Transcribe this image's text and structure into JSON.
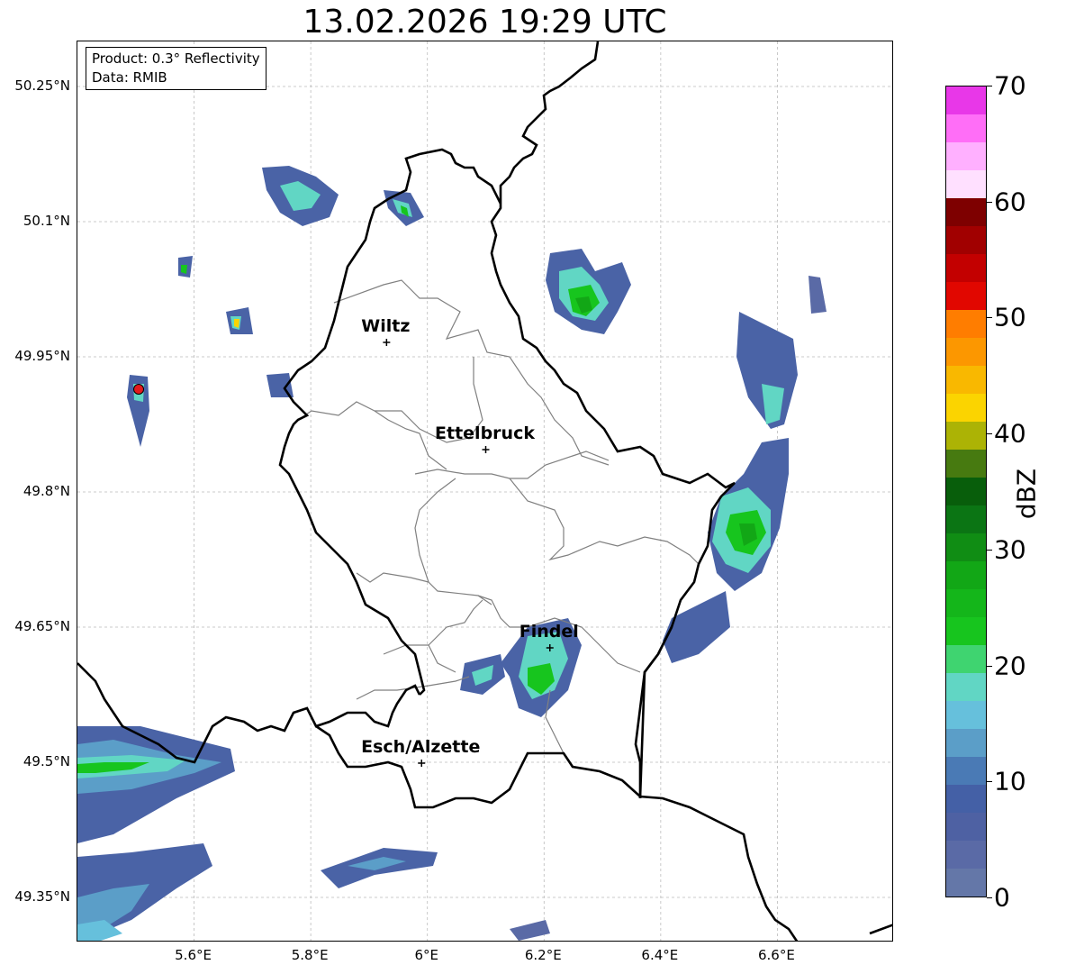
{
  "title": "13.02.2026 19:29 UTC",
  "info_box": {
    "product": "Product: 0.3° Reflectivity",
    "data": "Data: RMIB"
  },
  "y_ticks": [
    "50.25°N",
    "50.1°N",
    "49.95°N",
    "49.8°N",
    "49.65°N",
    "49.5°N",
    "49.35°N"
  ],
  "x_ticks": [
    "5.6°E",
    "5.8°E",
    "6°E",
    "6.2°E",
    "6.4°E",
    "6.6°E"
  ],
  "cities": [
    {
      "name": "Wiltz",
      "lon": 5.93,
      "lat": 49.966
    },
    {
      "name": "Ettelbruck",
      "lon": 6.1,
      "lat": 49.847
    },
    {
      "name": "Findel",
      "lon": 6.21,
      "lat": 49.627
    },
    {
      "name": "Esch/Alzette",
      "lon": 5.99,
      "lat": 49.499
    }
  ],
  "radar_site": {
    "lon": 5.505,
    "lat": 49.914,
    "color": "#e31a1c"
  },
  "colorbar": {
    "label": "dBZ",
    "ticks": [
      "0",
      "10",
      "20",
      "30",
      "40",
      "50",
      "60",
      "70"
    ],
    "colors": [
      "#6477a8",
      "#5a6aa6",
      "#4e61a3",
      "#4460a6",
      "#4a7ab5",
      "#5b9ec8",
      "#66c0dc",
      "#61d6c4",
      "#3fd470",
      "#17c51e",
      "#14b61a",
      "#12a716",
      "#108d14",
      "#0b7514",
      "#085e0b",
      "#477a10",
      "#acb305",
      "#fbd400",
      "#f9b800",
      "#fc9700",
      "#ff7d00",
      "#e10700",
      "#c30000",
      "#a10000",
      "#7e0000",
      "#ffe0ff",
      "#ffb0ff",
      "#ff6ef7",
      "#e837e8"
    ]
  },
  "extent": {
    "lon_min": 5.4,
    "lon_max": 6.8,
    "lat_min": 49.3,
    "lat_max": 50.3
  }
}
